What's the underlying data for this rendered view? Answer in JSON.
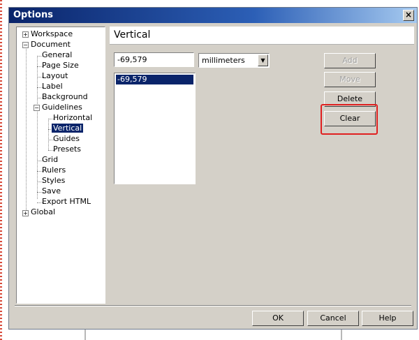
{
  "window": {
    "title": "Options",
    "close_glyph": "×"
  },
  "tree": {
    "items": [
      {
        "label": "Workspace",
        "expander": "+"
      },
      {
        "label": "Document",
        "expander": "−"
      },
      {
        "label": "General"
      },
      {
        "label": "Page Size"
      },
      {
        "label": "Layout"
      },
      {
        "label": "Label"
      },
      {
        "label": "Background"
      },
      {
        "label": "Guidelines",
        "expander": "−"
      },
      {
        "label": "Horizontal"
      },
      {
        "label": "Vertical",
        "selected": true
      },
      {
        "label": "Guides"
      },
      {
        "label": "Presets"
      },
      {
        "label": "Grid"
      },
      {
        "label": "Rulers"
      },
      {
        "label": "Styles"
      },
      {
        "label": "Save"
      },
      {
        "label": "Export HTML"
      },
      {
        "label": "Global",
        "expander": "+"
      }
    ]
  },
  "panel": {
    "title": "Vertical",
    "value_input": "-69,579",
    "unit_select": "millimeters",
    "guides_list": [
      "-69,579"
    ],
    "buttons": {
      "add": "Add",
      "move": "Move",
      "delete": "Delete",
      "clear": "Clear"
    }
  },
  "footer": {
    "ok": "OK",
    "cancel": "Cancel",
    "help": "Help"
  },
  "colors": {
    "highlight": "#e02020",
    "selection": "#0a246a",
    "titlebar": "#0a246a"
  }
}
